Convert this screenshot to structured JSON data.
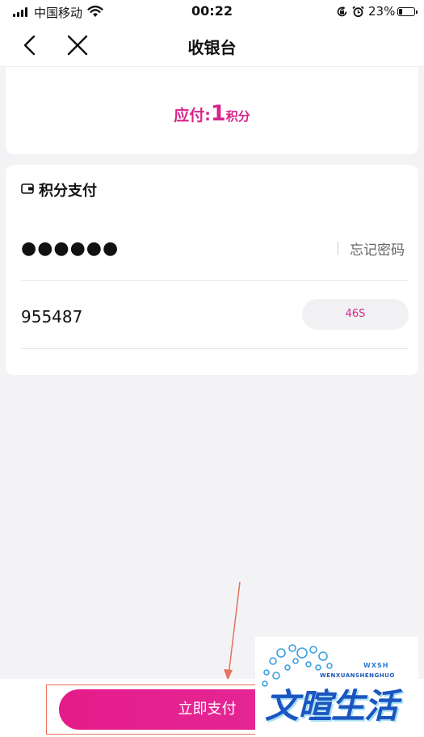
{
  "status_bar": {
    "carrier": "中国移动",
    "time": "00:22",
    "battery_percent": "23%",
    "battery_level": 0.23,
    "icons": [
      "signal-icon",
      "wifi-icon",
      "rotation-lock-icon",
      "alarm-icon",
      "battery-icon"
    ]
  },
  "nav": {
    "title": "收银台",
    "back_icon": "chevron-left-icon",
    "close_icon": "close-icon"
  },
  "amount": {
    "label": "应付:",
    "value": "1",
    "unit": "积分"
  },
  "payment": {
    "method_icon": "wallet-icon",
    "method_label": "积分支付",
    "password_value": "●●●●●●",
    "forgot_password": "忘记密码",
    "code_value": "955487",
    "countdown": "46S"
  },
  "actions": {
    "pay_button": "立即支付"
  },
  "colors": {
    "accent": "#d8248a",
    "button": "#e41c8a",
    "annotation": "#e8715f",
    "background": "#f3f3f5"
  },
  "watermark": {
    "letters": "WXSH",
    "subtitle": "WENXUANSHENGHUO",
    "main": "文暄生活"
  }
}
